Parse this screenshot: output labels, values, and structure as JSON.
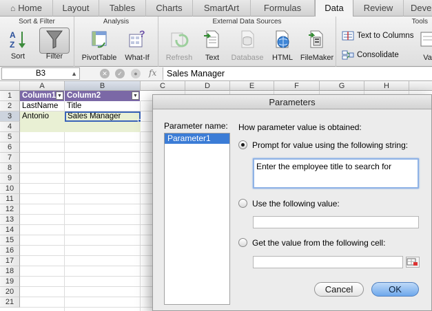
{
  "ribbon_tabs": [
    {
      "label": "Home",
      "active": false
    },
    {
      "label": "Layout",
      "active": false
    },
    {
      "label": "Tables",
      "active": false
    },
    {
      "label": "Charts",
      "active": false
    },
    {
      "label": "SmartArt",
      "active": false
    },
    {
      "label": "Formulas",
      "active": false
    },
    {
      "label": "Data",
      "active": true
    },
    {
      "label": "Review",
      "active": false
    },
    {
      "label": "Deve",
      "active": false
    }
  ],
  "ribbon": {
    "sort_filter": {
      "title": "Sort & Filter",
      "sort_label": "Sort",
      "filter_label": "Filter"
    },
    "analysis": {
      "title": "Analysis",
      "pivottable_label": "PivotTable",
      "whatif_label": "What-If"
    },
    "external": {
      "title": "External Data Sources",
      "refresh_label": "Refresh",
      "text_label": "Text",
      "database_label": "Database",
      "html_label": "HTML",
      "filemaker_label": "FileMaker"
    },
    "tools": {
      "title": "Tools",
      "text_to_columns_label": "Text to Columns",
      "consolidate_label": "Consolidate",
      "cut_label": "Vali"
    }
  },
  "formula_bar": {
    "name_box": "B3",
    "fx": "fx",
    "formula": "Sales Manager"
  },
  "grid": {
    "columns": [
      "A",
      "B",
      "C",
      "D",
      "E",
      "F",
      "G",
      "H"
    ],
    "rows": [
      "1",
      "2",
      "3",
      "4",
      "5",
      "6",
      "7",
      "8",
      "9",
      "10",
      "11",
      "12",
      "13",
      "14",
      "15",
      "16",
      "17",
      "18",
      "19",
      "20",
      "21"
    ],
    "table_headers": [
      "Column1",
      "Column2"
    ],
    "row2": [
      "LastName",
      "Title"
    ],
    "row3": [
      "Antonio",
      "Sales Manager"
    ],
    "dropdown_glyph": "▼"
  },
  "dialog": {
    "title": "Parameters",
    "parameter_name_label": "Parameter name:",
    "parameters": [
      "Parameter1"
    ],
    "how_label": "How parameter value is obtained:",
    "option_prompt": "Prompt for value using the following string:",
    "prompt_text": "Enter the employee title to search for",
    "option_value": "Use the following value:",
    "value_text": "",
    "option_cell": "Get the value from the following cell:",
    "cell_text": "",
    "cancel_label": "Cancel",
    "ok_label": "OK"
  },
  "colors": {
    "table_header": "#7b68a6",
    "table_fill": "#e9f0d4",
    "selection": "#3b7cd6",
    "ok_button": "#6ea8ec"
  }
}
